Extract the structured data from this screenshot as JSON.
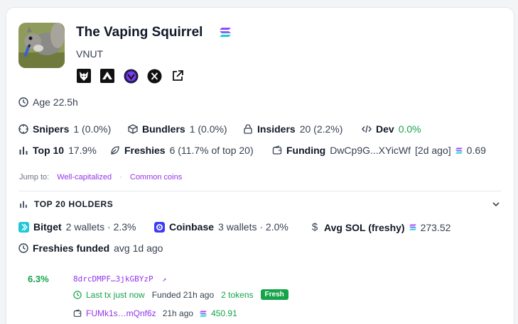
{
  "token": {
    "name": "The Vaping Squirrel",
    "ticker": "VNUT"
  },
  "socials": [
    "wolf-icon",
    "pump-icon",
    "shield-icon",
    "x-icon",
    "external-link-icon"
  ],
  "stats": {
    "age": "Age 22.5h",
    "snipers_label": "Snipers",
    "snipers_value": "1 (0.0%)",
    "bundlers_label": "Bundlers",
    "bundlers_value": "1 (0.0%)",
    "insiders_label": "Insiders",
    "insiders_value": "20 (2.2%)",
    "dev_label": "Dev",
    "dev_value": "0.0%",
    "top10_label": "Top 10",
    "top10_value": "17.9%",
    "freshies_label": "Freshies",
    "freshies_value": "6 (11.7% of top 20)",
    "funding_label": "Funding",
    "funding_address": "DwCp9G...XYicWf",
    "funding_age": "[2d ago]",
    "funding_sol": "0.69"
  },
  "jump": {
    "label": "Jump to:",
    "link1": "Well-capitalized",
    "sep": "·",
    "link2": "Common coins"
  },
  "holders": {
    "section_title": "TOP 20 HOLDERS",
    "bitget_label": "Bitget",
    "bitget_value": "2 wallets · 2.3%",
    "coinbase_label": "Coinbase",
    "coinbase_value": "3 wallets · 2.0%",
    "avg_sol_label": "Avg SOL (freshy)",
    "avg_sol_value": "273.52",
    "freshies_funded_label": "Freshies funded",
    "freshies_funded_value": "avg 1d ago"
  },
  "holder1": {
    "pct": "6.3%",
    "address": "8drcDMPF…3jkGBYzP",
    "last_tx": "Last tx just now",
    "funded": "Funded 21h ago",
    "tokens": "2 tokens",
    "badge": "Fresh",
    "funder": "FUMk1s…mQnf6z",
    "funder_age": "21h ago",
    "funder_sol": "450.91"
  },
  "colors": {
    "accent": "#9333ea",
    "green": "#16a34a"
  }
}
